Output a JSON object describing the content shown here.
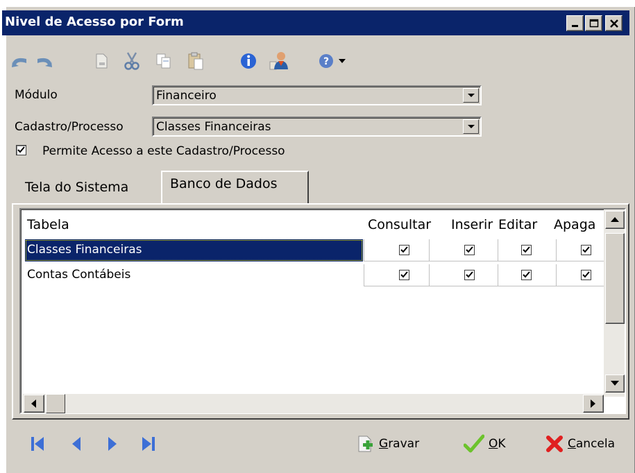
{
  "window": {
    "title": "Nivel de Acesso por Form"
  },
  "form": {
    "modulo_label": "Módulo",
    "modulo_value": "Financeiro",
    "cadastro_label": "Cadastro/Processo",
    "cadastro_value": "Classes Financeiras",
    "permite_label": "Permite Acesso a este Cadastro/Processo",
    "permite_checked": true
  },
  "tabs": [
    {
      "label": "Tela do Sistema",
      "active": false
    },
    {
      "label": "Banco de Dados",
      "active": true
    }
  ],
  "grid": {
    "columns": [
      "Tabela",
      "Consultar",
      "Inserir",
      "Editar",
      "Apaga"
    ],
    "rows": [
      {
        "tabela": "Classes Financeiras",
        "consultar": true,
        "inserir": true,
        "editar": true,
        "apagar": true,
        "selected": true
      },
      {
        "tabela": "Contas Contábeis",
        "consultar": true,
        "inserir": true,
        "editar": true,
        "apagar": true,
        "selected": false
      }
    ]
  },
  "actions": {
    "gravar_prefix": "",
    "gravar_underlined": "G",
    "gravar_rest": "ravar",
    "ok_underlined": "O",
    "ok_rest": "K",
    "cancela_underlined": "C",
    "cancela_rest": "ancela"
  },
  "icons": [
    "undo-icon",
    "redo-icon",
    "new-document-icon",
    "cut-icon",
    "copy-icon",
    "paste-icon",
    "info-icon",
    "user-icon",
    "help-icon",
    "dropdown-arrow-icon",
    "first-record-icon",
    "previous-record-icon",
    "next-record-icon",
    "last-record-icon",
    "save-icon",
    "check-icon",
    "cancel-icon"
  ]
}
